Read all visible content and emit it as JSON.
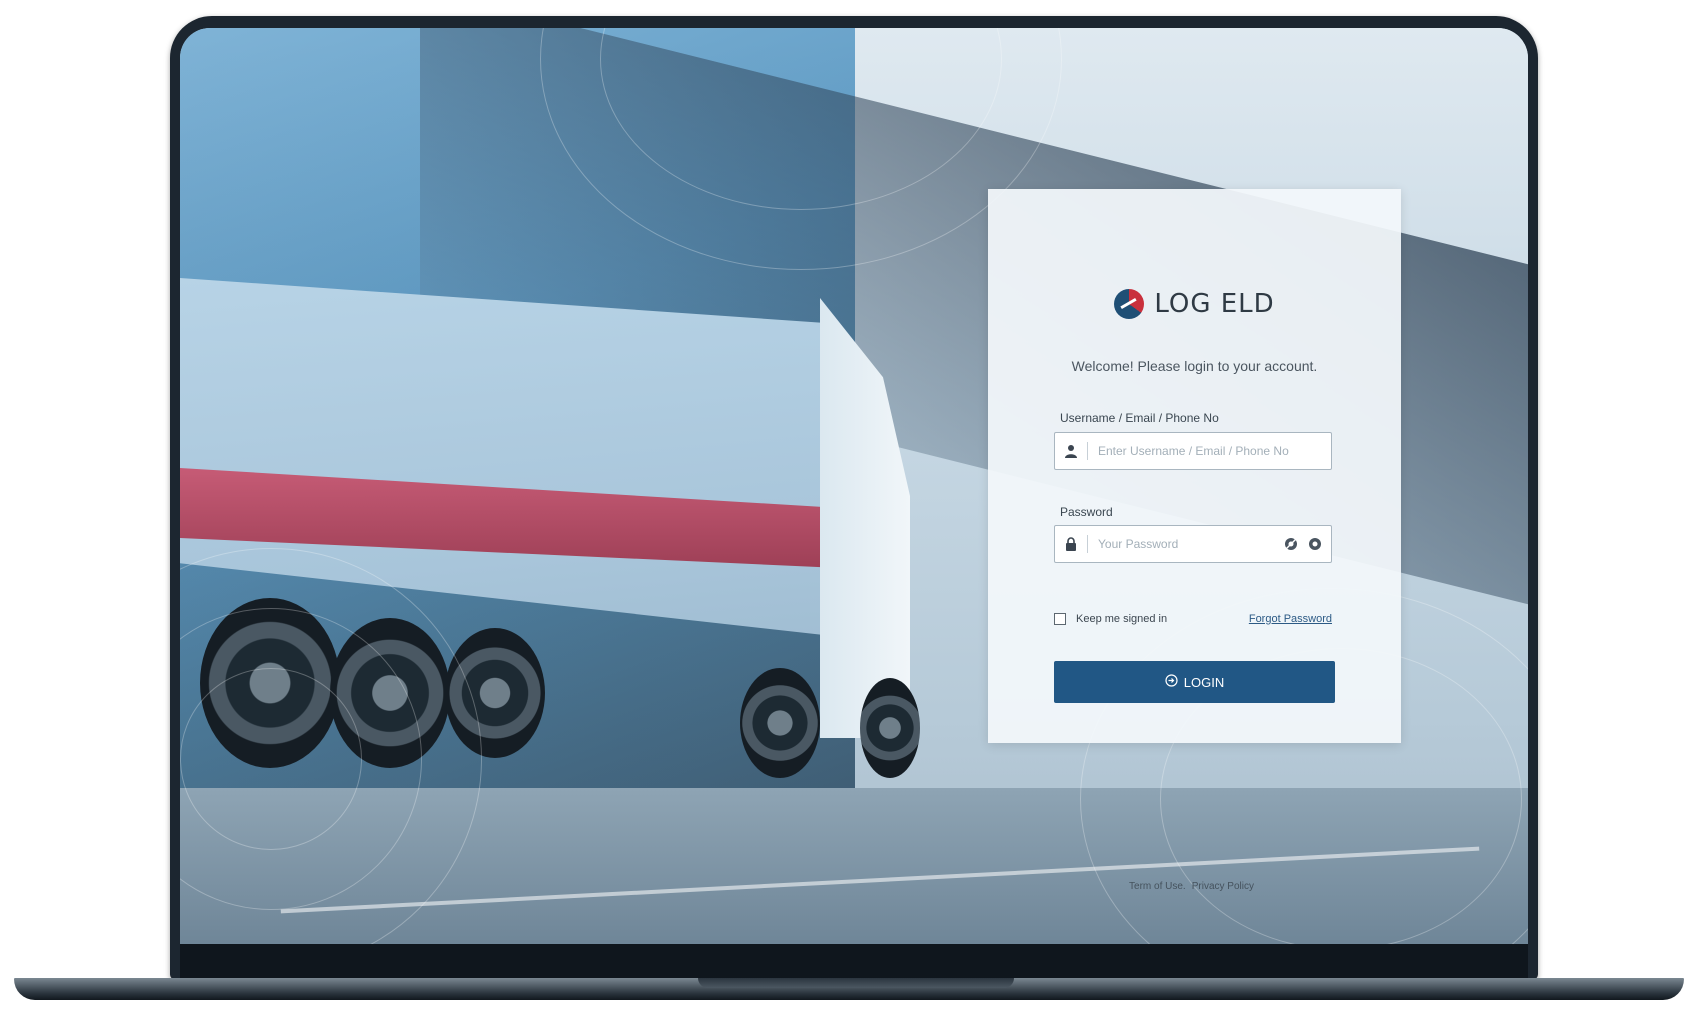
{
  "brand": {
    "name": "LOG ELD",
    "logo_icon": "log-eld-logo-icon"
  },
  "login": {
    "welcome": "Welcome! Please login to your account.",
    "username_label": "Username / Email / Phone No",
    "username_placeholder": "Enter Username / Email / Phone No",
    "username_value": "",
    "password_label": "Password",
    "password_placeholder": "Your Password",
    "password_value": "",
    "keep_signed_in": "Keep me signed in",
    "keep_signed_in_checked": false,
    "forgot_password": "Forgot Password",
    "login_button": "LOGIN",
    "icons": {
      "username": "user-icon",
      "password": "lock-icon",
      "visibility": "eye-icon",
      "settings": "gear-icon",
      "login": "login-icon"
    }
  },
  "footer": {
    "terms": "Term of Use.",
    "privacy": "Privacy Policy"
  },
  "colors": {
    "primary": "#215785",
    "brand_red": "#c9303c",
    "brand_blue": "#1f4f75"
  }
}
